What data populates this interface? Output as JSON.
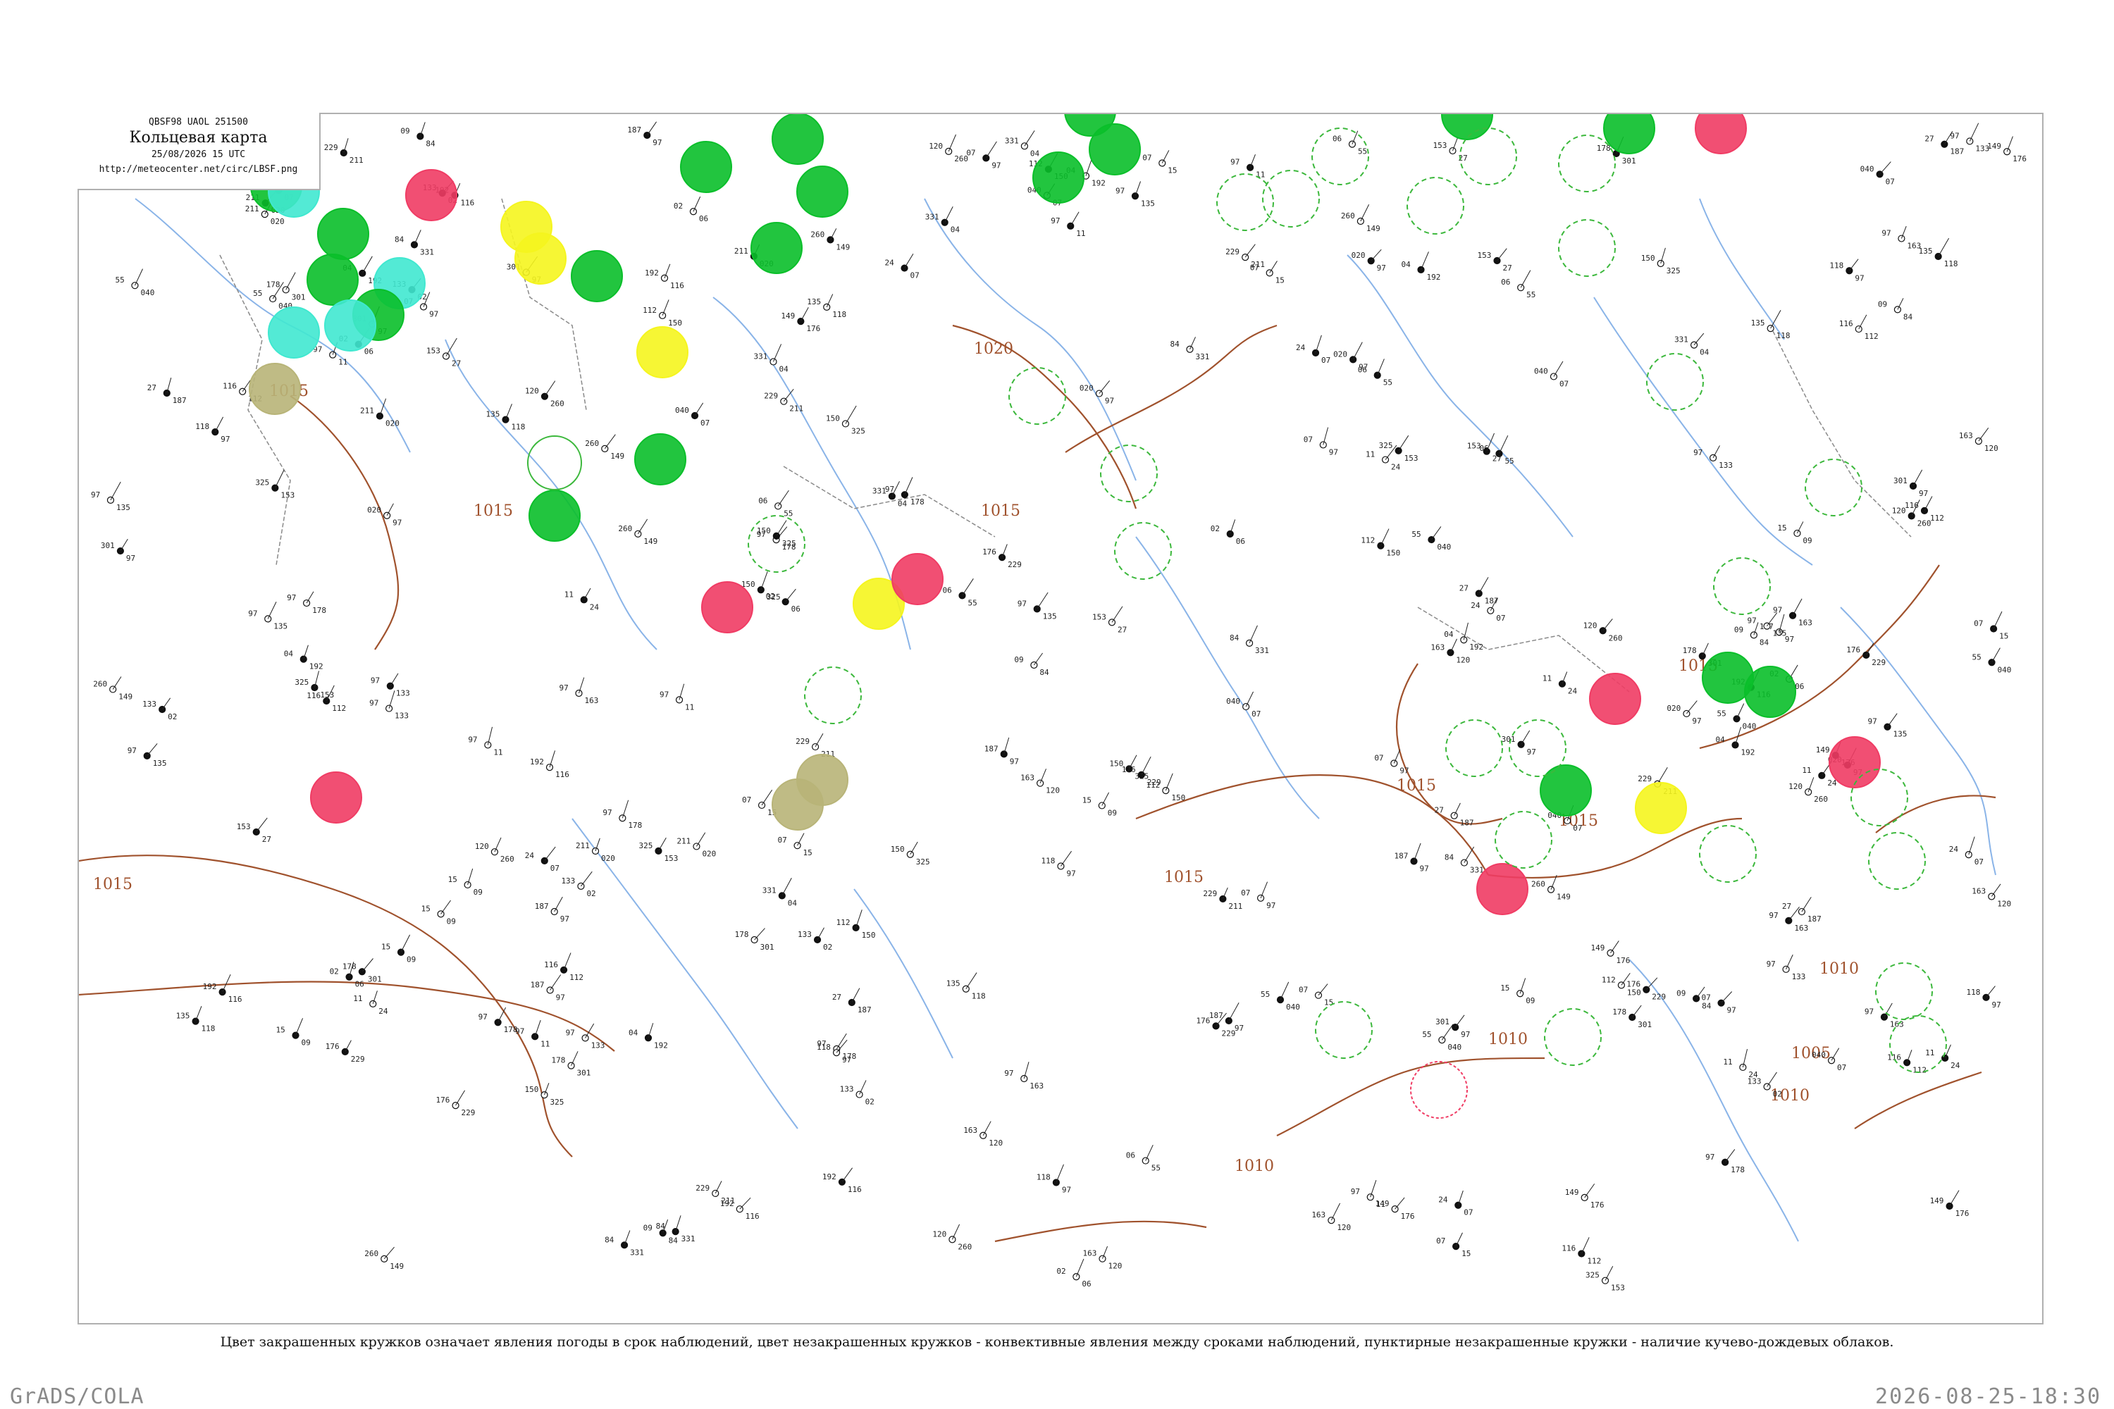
{
  "header": {
    "code": "QBSF98  UAOL  251500",
    "title": "Кольцевая карта",
    "timestamp": "25/08/2026 15 UTC",
    "url": "http://meteocenter.net/circ/LBSF.png"
  },
  "caption": "Цвет закрашенных кружков означает явления погоды в срок наблюдений, цвет незакрашенных кружков - конвективные явления между сроками наблюдений, пунктирные незакрашенные кружки - наличие кучево-дождевых облаков.",
  "footer": {
    "software": "GrADS/COLA",
    "generated": "2026-08-25-18:30"
  },
  "colors": {
    "isobar": "#a0522d",
    "river": "#8ab4e8",
    "border": "#8a8a8a",
    "rain": "#0abf2a",
    "shower": "#40e8d0",
    "thunderstorm": "#f03c64",
    "fog": "#f5f51e",
    "haze": "#b8b478",
    "cb_dashed": "#3cb83c"
  },
  "isobar_labels": [
    "1015",
    "1015",
    "1015",
    "1020",
    "1015",
    "1015",
    "1015",
    "1010",
    "1010",
    "1010",
    "1015",
    "1005",
    "1015",
    "1010"
  ],
  "station_values": [
    "163",
    "97",
    "04",
    "187",
    "133",
    "120",
    "11",
    "192",
    "97",
    "02",
    "260",
    "24",
    "116",
    "178",
    "06",
    "149",
    "07",
    "112",
    "301",
    "55",
    "176",
    "15",
    "150",
    "97",
    "040",
    "229",
    "09",
    "325",
    "135",
    "07",
    "211",
    "84",
    "153",
    "118",
    "97",
    "020",
    "331",
    "27",
    "97"
  ]
}
